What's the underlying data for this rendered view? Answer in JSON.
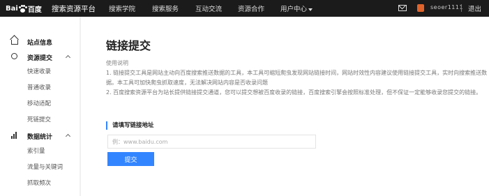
{
  "header": {
    "logo_text_left": "Bai",
    "logo_text_right": "百度",
    "platform_title": "搜索资源平台",
    "nav": [
      {
        "label": "搜索学院"
      },
      {
        "label": "搜索服务"
      },
      {
        "label": "互动交流"
      },
      {
        "label": "资源合作"
      },
      {
        "label": "用户中心"
      }
    ],
    "username": "seoer1111",
    "logout": "退出"
  },
  "sidebar": {
    "groups": [
      {
        "label": "站点信息",
        "icon": "home-icon"
      },
      {
        "label": "资源提交",
        "icon": "resource-icon",
        "items": [
          "快速收录",
          "普通收录",
          "移动适配",
          "死链提交"
        ]
      },
      {
        "label": "数据统计",
        "icon": "chart-icon",
        "items": [
          "索引量",
          "流量与关键词",
          "抓取频次"
        ]
      }
    ]
  },
  "main": {
    "title": "链接提交",
    "usage_title": "使用说明",
    "paragraphs": [
      "1. 链接提交工具是网站主动向百度搜索推送数据的工具，本工具可缩短爬虫发现网站链接时间，网站时效性内容建议使用链接提交工具，实时向搜索推送数",
      "据。本工具可加快爬虫抓取速度，无法解决网站内容是否收录问题",
      "2. 百度搜索资源平台为站长提供链接提交通道，您可以提交想被百度收录的链接，百度搜索引擎会按照标准处理，但不保证一定能够收录您提交的链接。"
    ],
    "form_label": "请填写链接地址",
    "input_placeholder": "例：www.baidu.com",
    "input_value": "",
    "submit_label": "提交"
  },
  "colors": {
    "topbar": "#1b1b1b",
    "accent": "#3385ff",
    "avatar": "#e0632b"
  }
}
